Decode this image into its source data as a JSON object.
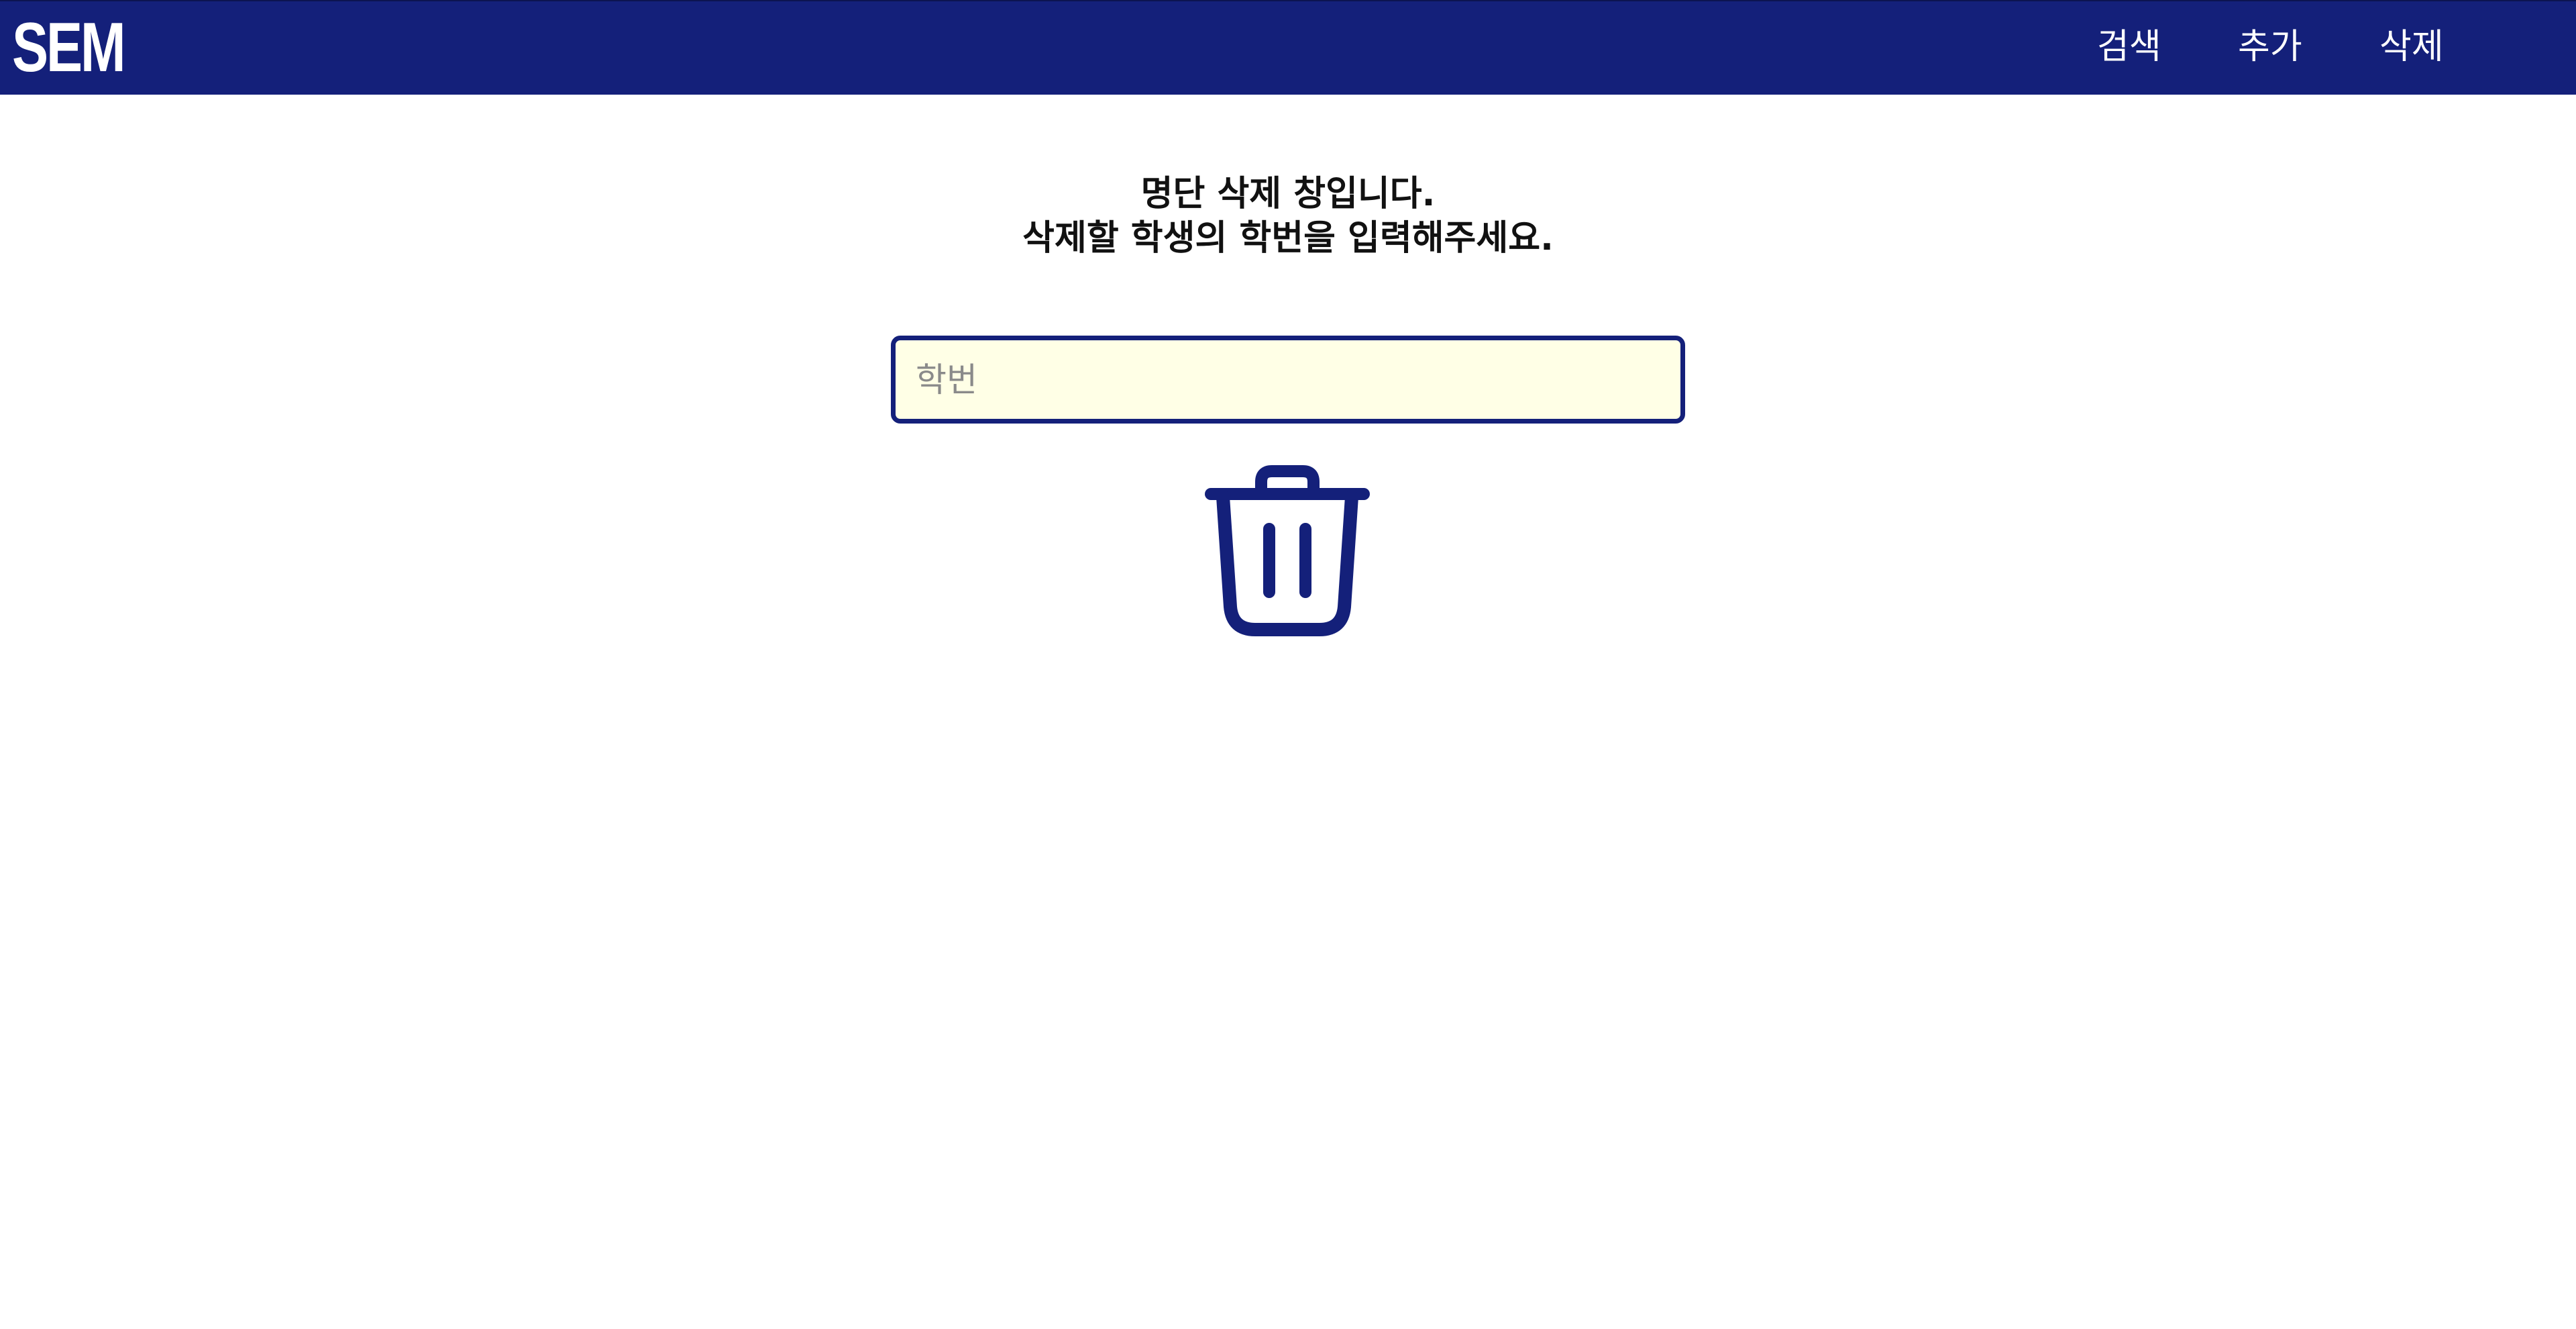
{
  "header": {
    "logo": "SEM",
    "nav": [
      {
        "label": "검색"
      },
      {
        "label": "추가"
      },
      {
        "label": "삭제"
      }
    ],
    "background_color": "#14207a"
  },
  "main": {
    "heading_line1": "명단 삭제 창입니다.",
    "heading_line2": "삭제할 학생의 학번을 입력해주세요.",
    "student_id_input": {
      "value": "",
      "placeholder": "학번",
      "background_color": "#ffffe6",
      "border_color": "#14207a"
    },
    "delete_button": {
      "icon": "trash-icon",
      "color": "#14207a"
    }
  }
}
